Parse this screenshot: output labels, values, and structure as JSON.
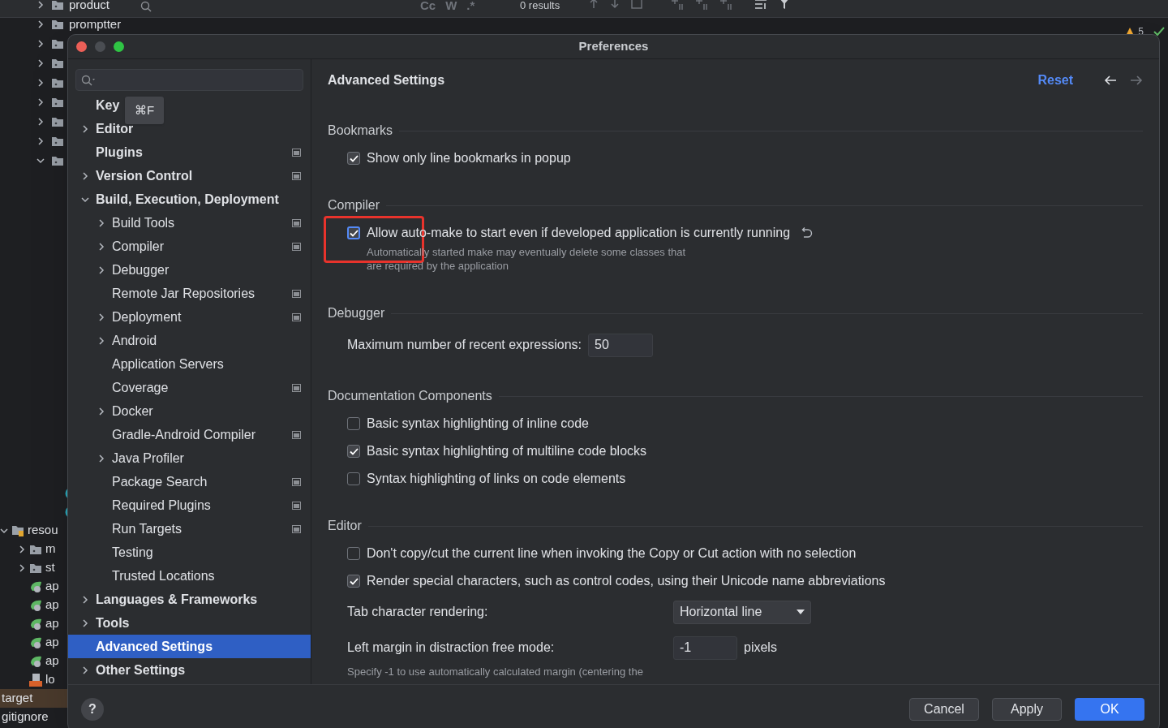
{
  "ide": {
    "tree_top": [
      {
        "label": "product",
        "expanded": false
      },
      {
        "label": "promptter",
        "expanded": false
      },
      {
        "expanded": false
      },
      {
        "expanded": false
      },
      {
        "expanded": false
      },
      {
        "expanded": false
      },
      {
        "expanded": false
      },
      {
        "expanded": false
      },
      {
        "expanded": true
      }
    ],
    "toolbar": {
      "options": [
        "Cc",
        "W",
        ".*"
      ],
      "results": "0 results"
    },
    "warnings": "5",
    "tree_bottom": [
      {
        "kind": "class",
        "selected": false
      },
      {
        "kind": "class",
        "selected": false
      },
      {
        "kind": "resources",
        "label": "resou",
        "expanded": true,
        "selected": false,
        "children": [
          {
            "kind": "folder",
            "label": "m",
            "expanded": false,
            "selected": false
          },
          {
            "kind": "folder",
            "label": "st",
            "expanded": false,
            "selected": false
          },
          {
            "kind": "spring",
            "label": "ap",
            "selected": false
          },
          {
            "kind": "spring",
            "label": "ap",
            "selected": false
          },
          {
            "kind": "spring",
            "label": "ap",
            "selected": false
          },
          {
            "kind": "spring",
            "label": "ap",
            "selected": false
          },
          {
            "kind": "spring",
            "label": "ap",
            "selected": false
          },
          {
            "kind": "log",
            "label": "lo",
            "selected": false
          }
        ]
      },
      {
        "kind": "plain",
        "label": "target",
        "selected": true
      },
      {
        "kind": "plain",
        "label": "gitignore",
        "selected": false
      }
    ]
  },
  "dialog": {
    "title": "Preferences",
    "tooltip": "⌘F",
    "sidebar": [
      {
        "label": "Key",
        "project_level": false,
        "selected": false
      },
      {
        "label": "Editor",
        "expanded": false,
        "project_level": false,
        "selected": false
      },
      {
        "label": "Plugins",
        "project_level": true,
        "selected": false
      },
      {
        "label": "Version Control",
        "expanded": false,
        "project_level": true,
        "selected": false
      },
      {
        "label": "Build, Execution, Deployment",
        "expanded": true,
        "project_level": false,
        "selected": false,
        "children": [
          {
            "label": "Build Tools",
            "expanded": false,
            "project_level": true,
            "selected": false
          },
          {
            "label": "Compiler",
            "expanded": false,
            "project_level": true,
            "selected": false
          },
          {
            "label": "Debugger",
            "expanded": false,
            "project_level": false,
            "selected": false
          },
          {
            "label": "Remote Jar Repositories",
            "project_level": true,
            "selected": false
          },
          {
            "label": "Deployment",
            "expanded": false,
            "project_level": true,
            "selected": false
          },
          {
            "label": "Android",
            "expanded": false,
            "project_level": false,
            "selected": false
          },
          {
            "label": "Application Servers",
            "project_level": false,
            "selected": false
          },
          {
            "label": "Coverage",
            "project_level": true,
            "selected": false
          },
          {
            "label": "Docker",
            "expanded": false,
            "project_level": false,
            "selected": false
          },
          {
            "label": "Gradle-Android Compiler",
            "project_level": true,
            "selected": false
          },
          {
            "label": "Java Profiler",
            "expanded": false,
            "project_level": false,
            "selected": false
          },
          {
            "label": "Package Search",
            "project_level": true,
            "selected": false
          },
          {
            "label": "Required Plugins",
            "project_level": true,
            "selected": false
          },
          {
            "label": "Run Targets",
            "project_level": true,
            "selected": false
          },
          {
            "label": "Testing",
            "project_level": false,
            "selected": false
          },
          {
            "label": "Trusted Locations",
            "project_level": false,
            "selected": false
          }
        ]
      },
      {
        "label": "Languages & Frameworks",
        "expanded": false,
        "project_level": false,
        "selected": false
      },
      {
        "label": "Tools",
        "expanded": false,
        "project_level": false,
        "selected": false
      },
      {
        "label": "Advanced Settings",
        "project_level": false,
        "selected": true
      },
      {
        "label": "Other Settings",
        "expanded": false,
        "project_level": false,
        "selected": false
      }
    ],
    "content": {
      "title": "Advanced Settings",
      "reset": "Reset",
      "nav": [
        {
          "kind": "back",
          "disabled": false
        },
        {
          "kind": "forward",
          "disabled": true
        }
      ],
      "sections": [
        {
          "title": "Bookmarks",
          "items": [
            {
              "kind": "checkbox",
              "label": "Show only line bookmarks in popup",
              "checked": true,
              "focused": false,
              "modified": false,
              "annotated": false
            }
          ]
        },
        {
          "title": "Compiler",
          "items": [
            {
              "kind": "checkbox",
              "label": "Allow auto-make to start even if developed application is currently running",
              "checked": true,
              "focused": true,
              "modified": true,
              "annotated": true,
              "description": "Automatically started make may eventually delete some classes that\nare required by the application"
            }
          ]
        },
        {
          "title": "Debugger",
          "items": [
            {
              "kind": "number",
              "label": "Maximum number of recent expressions:",
              "value": "50"
            }
          ]
        },
        {
          "title": "Documentation Components",
          "items": [
            {
              "kind": "checkbox",
              "label": "Basic syntax highlighting of inline code",
              "checked": false,
              "focused": false,
              "modified": false,
              "annotated": false
            },
            {
              "kind": "checkbox",
              "label": "Basic syntax highlighting of multiline code blocks",
              "checked": true,
              "focused": false,
              "modified": false,
              "annotated": false
            },
            {
              "kind": "checkbox",
              "label": "Syntax highlighting of links on code elements",
              "checked": false,
              "focused": false,
              "modified": false,
              "annotated": false
            }
          ]
        },
        {
          "title": "Editor",
          "items": [
            {
              "kind": "checkbox",
              "label": "Don't copy/cut the current line when invoking the Copy or Cut action with no selection",
              "checked": false,
              "focused": false,
              "modified": false,
              "annotated": false
            },
            {
              "kind": "checkbox",
              "label": "Render special characters, such as control codes, using their Unicode name abbreviations",
              "checked": true,
              "focused": false,
              "modified": false,
              "annotated": false
            },
            {
              "kind": "dropdown",
              "label": "Tab character rendering:",
              "value": "Horizontal line"
            },
            {
              "kind": "number",
              "label": "Left margin in distraction free mode:",
              "value": "-1",
              "unit": "pixels",
              "description": "Specify -1 to use automatically calculated margin (centering the"
            }
          ]
        }
      ]
    },
    "help": "?",
    "buttons": [
      {
        "label": "Cancel",
        "primary": false
      },
      {
        "label": "Apply",
        "primary": false
      },
      {
        "label": "OK",
        "primary": true
      }
    ]
  }
}
